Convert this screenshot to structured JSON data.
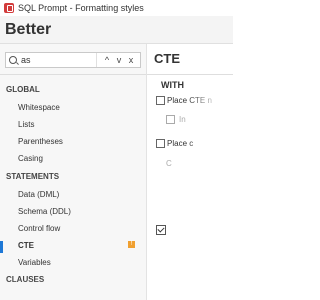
{
  "window": {
    "title": "SQL Prompt - Formatting styles"
  },
  "header": {
    "title": "Better"
  },
  "search": {
    "value": "as",
    "up": "^",
    "down": "v",
    "clear": "x"
  },
  "sidebar": {
    "groups": [
      {
        "label": "GLOBAL",
        "items": [
          "Whitespace",
          "Lists",
          "Parentheses",
          "Casing"
        ]
      },
      {
        "label": "STATEMENTS",
        "items": [
          "Data (DML)",
          "Schema (DDL)",
          "Control flow",
          "CTE",
          "Variables"
        ]
      },
      {
        "label": "CLAUSES"
      }
    ],
    "active_item": "CTE",
    "badge": "!"
  },
  "main": {
    "title": "CTE",
    "section": "WITH",
    "options": [
      {
        "label": "Place CTE n",
        "checked": false
      },
      {
        "label": "In",
        "checked": false,
        "disabled": true
      },
      {
        "label": "Place c",
        "checked": false
      },
      {
        "label": "C",
        "disabled": true
      }
    ]
  },
  "colors": {
    "accent": "#1e78d6",
    "badge": "#f0a030",
    "app_icon": "#d23b3b"
  }
}
